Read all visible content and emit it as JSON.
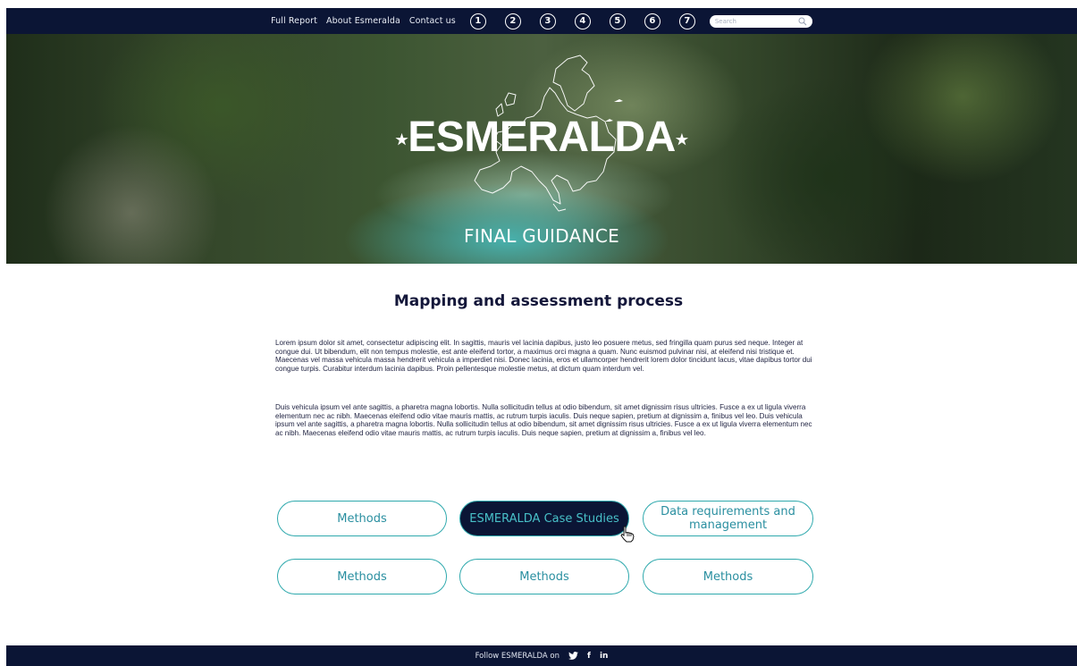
{
  "nav": {
    "links": [
      "Full Report",
      "About Esmeralda",
      "Contact us"
    ],
    "steps": [
      "1",
      "2",
      "3",
      "4",
      "5",
      "6",
      "7"
    ],
    "search_placeholder": "Search"
  },
  "hero": {
    "logo": "ESMERALDA",
    "subtitle": "FINAL GUIDANCE"
  },
  "main": {
    "title": "Mapping and assessment process",
    "paragraphs": [
      "Lorem ipsum dolor sit amet, consectetur adipiscing elit. In sagittis, mauris vel lacinia dapibus, justo leo posuere metus, sed fringilla quam purus sed neque. Integer at congue dui. Ut bibendum, elit non tempus molestie, est ante eleifend tortor, a maximus orci magna a quam. Nunc euismod pulvinar nisi, at eleifend nisi tristique et. Maecenas vel massa vehicula massa hendrerit vehicula a imperdiet nisi. Donec lacinia, eros et ullamcorper hendrerit lorem dolor tincidunt lacus, vitae dapibus tortor dui congue turpis. Curabitur interdum lacinia dapibus. Proin pellentesque molestie metus, at dictum quam interdum vel.",
      "Duis vehicula ipsum vel ante sagittis, a pharetra magna lobortis. Nulla sollicitudin tellus at odio bibendum, sit amet dignissim risus ultricies. Fusce a ex ut ligula viverra elementum nec ac nibh. Maecenas eleifend odio vitae mauris mattis, ac rutrum turpis iaculis. Duis neque sapien, pretium at dignissim a, finibus vel leo. Duis vehicula ipsum vel ante sagittis, a pharetra magna lobortis. Nulla sollicitudin tellus at odio bibendum, sit amet dignissim risus ultricies. Fusce a ex ut ligula viverra elementum nec ac nibh. Maecenas eleifend odio vitae mauris mattis, ac rutrum turpis iaculis. Duis neque sapien, pretium at dignissim a, finibus vel leo."
    ],
    "buttons": [
      {
        "label": "Methods"
      },
      {
        "label": "ESMERALDA Case Studies"
      },
      {
        "label": "Data requirements and management"
      },
      {
        "label": "Methods"
      },
      {
        "label": "Methods"
      },
      {
        "label": "Methods"
      }
    ]
  },
  "footer": {
    "follow_text": "Follow ESMERALDA on",
    "social": [
      "twitter-icon",
      "facebook-icon",
      "linkedin-icon"
    ]
  },
  "colors": {
    "navy": "#0b1535",
    "teal": "#2fa9ad",
    "button_text": "#2a8fa0"
  }
}
